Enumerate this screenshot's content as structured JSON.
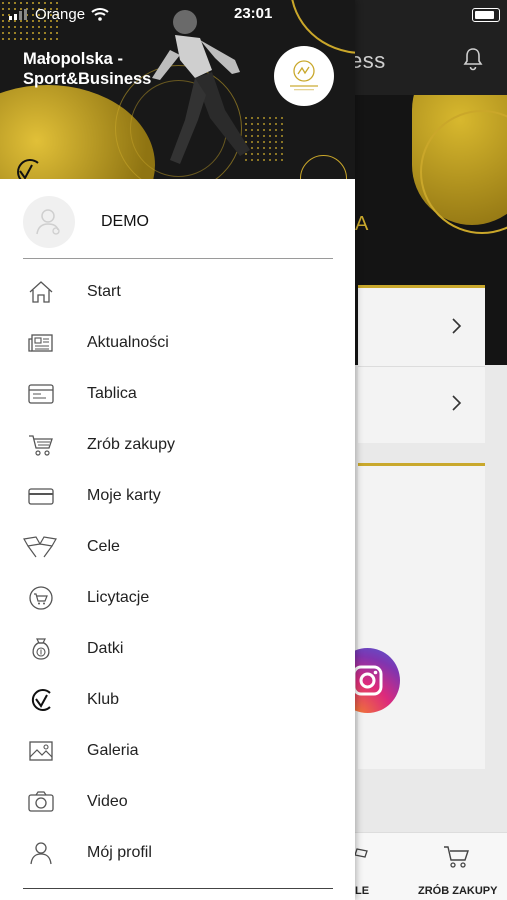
{
  "status_bar": {
    "carrier": "Orange",
    "time": "23:01"
  },
  "drawer": {
    "brand_line1": "Małopolska -",
    "brand_line2": "Sport&Business",
    "logo_text": "MAŁOPOLSKA SPORT & BUSINESS",
    "user_name": "DEMO",
    "menu": [
      {
        "label": "Start",
        "icon": "home-icon"
      },
      {
        "label": "Aktualności",
        "icon": "news-icon"
      },
      {
        "label": "Tablica",
        "icon": "board-icon"
      },
      {
        "label": "Zrób zakupy",
        "icon": "cart-icon"
      },
      {
        "label": "Moje karty",
        "icon": "card-icon"
      },
      {
        "label": "Cele",
        "icon": "flags-icon"
      },
      {
        "label": "Licytacje",
        "icon": "auction-icon"
      },
      {
        "label": "Datki",
        "icon": "money-bag-icon"
      },
      {
        "label": "Klub",
        "icon": "club-icon"
      },
      {
        "label": "Galeria",
        "icon": "gallery-icon"
      },
      {
        "label": "Video",
        "icon": "camera-icon"
      },
      {
        "label": "Mój profil",
        "icon": "profile-icon"
      }
    ]
  },
  "background_app": {
    "title_fragment": "ess",
    "hero_letter": "A",
    "tab_cele_fragment": "LE",
    "tab_shop": "ZRÓB ZAKUPY"
  },
  "colors": {
    "accent_gold": "#c9a82c",
    "dark": "#181818",
    "text": "#222222"
  }
}
